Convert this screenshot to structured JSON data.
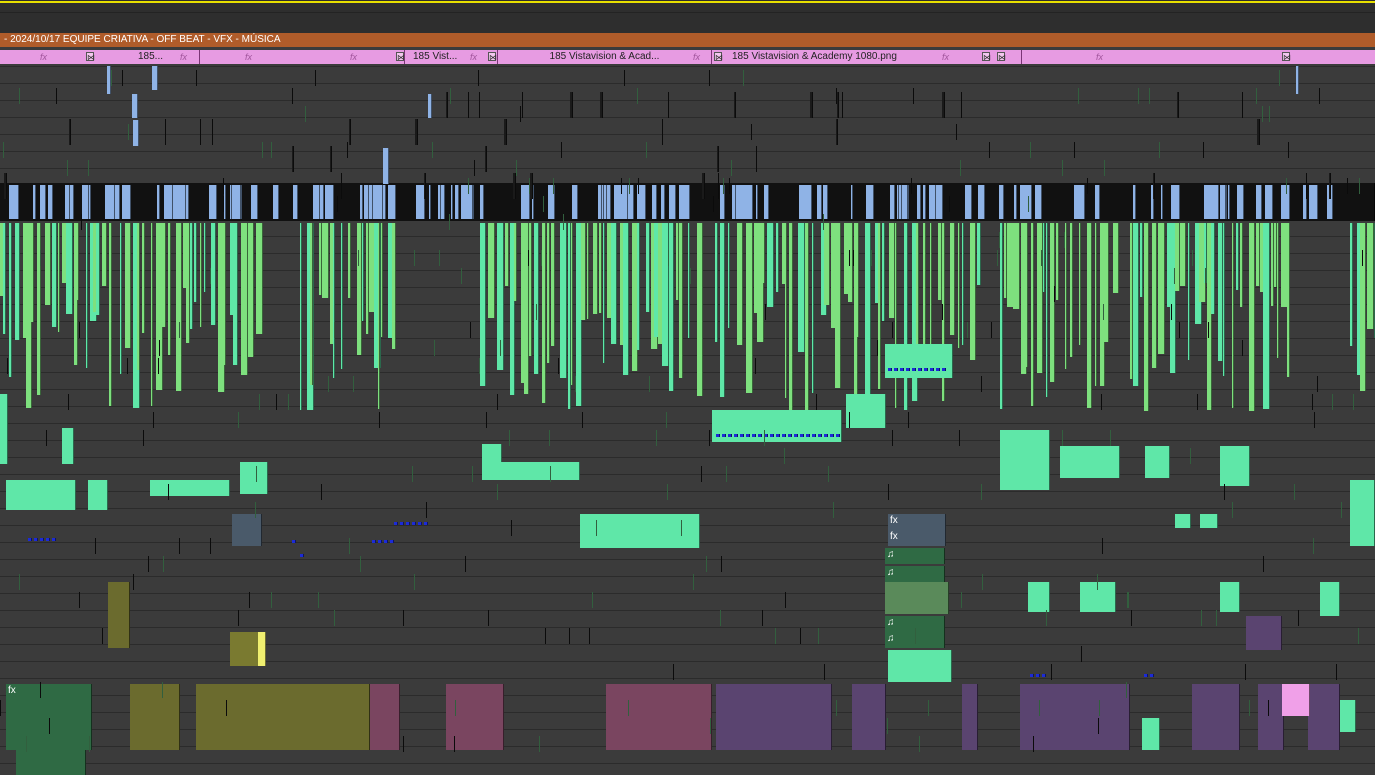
{
  "sequence": {
    "title": "- 2024/10/17 EQUIPE CRIATIVA - OFF BEAT - VFX - MÚSICA"
  },
  "adjustment_clips": [
    {
      "label": "185..."
    },
    {
      "label": "185 Vist..."
    },
    {
      "label": "185 Vistavision & Acad..."
    },
    {
      "label": "185 Vistavision & Academy 1080.png"
    }
  ],
  "icons": {
    "fx": "fx",
    "transition": "⋈",
    "audio": "♫"
  },
  "colors": {
    "background": "#3b3b3b",
    "sequence_bar": "#b05c2a",
    "adjustment": "#e79be2",
    "video_lavender": "#8fb3e6",
    "video_green": "#7ee07e",
    "video_mint": "#5fe7a8",
    "audio_olive": "#6b6b2e",
    "audio_mauve": "#7a4560",
    "audio_purple": "#5a4470",
    "audio_dark_green": "#2f6a44",
    "playhead": "#e8e000"
  }
}
